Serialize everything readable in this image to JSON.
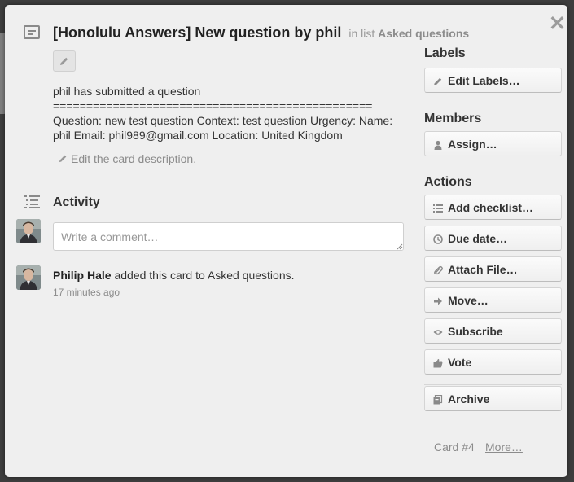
{
  "card": {
    "title": "[Honolulu Answers] New question by phil",
    "in_list_prefix": "in list",
    "list_name": "Asked questions",
    "close_glyph": "✕",
    "description_lines": [
      "phil has submitted a question",
      "================================================",
      "Question: new test question Context: test question Urgency: Name:",
      "phil Email: phil989@gmail.com Location: United Kingdom"
    ],
    "edit_description_label": "Edit the card description."
  },
  "activity": {
    "heading": "Activity",
    "comment_placeholder": "Write a comment…",
    "entries": [
      {
        "member": "Philip Hale",
        "text": "added this card to Asked questions.",
        "time": "17 minutes ago"
      }
    ]
  },
  "sidebar": {
    "labels_heading": "Labels",
    "members_heading": "Members",
    "actions_heading": "Actions",
    "edit_labels": "Edit Labels…",
    "assign": "Assign…",
    "actions": [
      {
        "label": "Add checklist…",
        "icon": "checklist-icon"
      },
      {
        "label": "Due date…",
        "icon": "clock-icon"
      },
      {
        "label": "Attach File…",
        "icon": "paperclip-icon"
      },
      {
        "label": "Move…",
        "icon": "arrow-right-icon"
      },
      {
        "label": "Subscribe",
        "icon": "eye-icon"
      },
      {
        "label": "Vote",
        "icon": "thumbs-up-icon"
      }
    ],
    "archive": "Archive",
    "card_number": "Card #4",
    "more": "More…"
  },
  "colors": {
    "window_bg": "#efefef",
    "overlay_bg": "#3d3d3d",
    "muted_text": "#8c8c8c"
  }
}
